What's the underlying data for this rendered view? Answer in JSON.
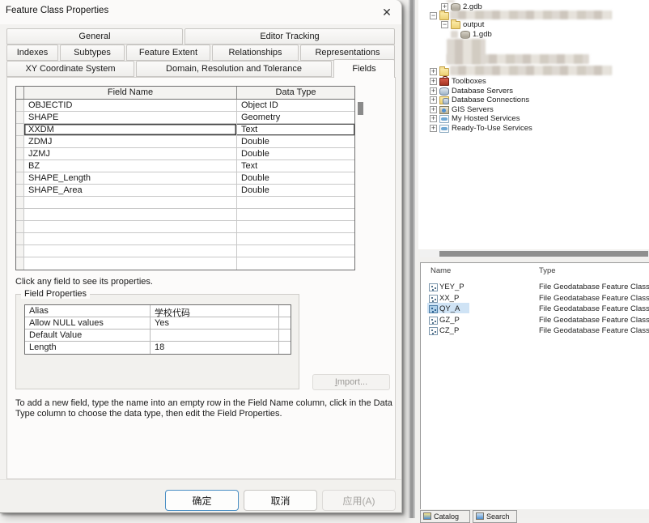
{
  "icons": {
    "close": "✕",
    "plus": "+",
    "minus": "−"
  },
  "dialog": {
    "title": "Feature Class Properties",
    "tabs": {
      "general": "General",
      "editor_tracking": "Editor Tracking",
      "indexes": "Indexes",
      "subtypes": "Subtypes",
      "feature_extent": "Feature Extent",
      "relationships": "Relationships",
      "representations": "Representations",
      "xy_coordinate_system": "XY Coordinate System",
      "domain_resolution_tolerance": "Domain, Resolution and Tolerance",
      "fields": "Fields"
    },
    "fields_table": {
      "header_name": "Field Name",
      "header_type": "Data Type",
      "rows": [
        {
          "name": "OBJECTID",
          "type": "Object ID"
        },
        {
          "name": "SHAPE",
          "type": "Geometry"
        },
        {
          "name": "XXDM",
          "type": "Text"
        },
        {
          "name": "ZDMJ",
          "type": "Double"
        },
        {
          "name": "JZMJ",
          "type": "Double"
        },
        {
          "name": "BZ",
          "type": "Text"
        },
        {
          "name": "SHAPE_Length",
          "type": "Double"
        },
        {
          "name": "SHAPE_Area",
          "type": "Double"
        }
      ]
    },
    "hint": "Click any field to see its properties.",
    "field_properties": {
      "title": "Field Properties",
      "rows": [
        {
          "label": "Alias",
          "value": "学校代码"
        },
        {
          "label": "Allow NULL values",
          "value": "Yes"
        },
        {
          "label": "Default Value",
          "value": ""
        },
        {
          "label": "Length",
          "value": "18"
        }
      ]
    },
    "import_button": "Import...",
    "instruction": "To add a new field, type the name into an empty row in the Field Name column, click in the Data Type column to choose the data type, then edit the Field Properties.",
    "buttons": {
      "ok": "确定",
      "cancel": "取消",
      "apply": "应用(A)"
    }
  },
  "catalog_tree": {
    "items": [
      {
        "label": "2.gdb"
      },
      {
        "label": "output"
      },
      {
        "label": "1.gdb"
      },
      {
        "label": "Toolboxes"
      },
      {
        "label": "Database Servers"
      },
      {
        "label": "Database Connections"
      },
      {
        "label": "GIS Servers"
      },
      {
        "label": "My Hosted Services"
      },
      {
        "label": "Ready-To-Use Services"
      }
    ]
  },
  "contents": {
    "col_name": "Name",
    "col_type": "Type",
    "rows": [
      {
        "name": "YEY_P",
        "type": "File Geodatabase Feature Class"
      },
      {
        "name": "XX_P",
        "type": "File Geodatabase Feature Class"
      },
      {
        "name": "QY_A",
        "type": "File Geodatabase Feature Class"
      },
      {
        "name": "GZ_P",
        "type": "File Geodatabase Feature Class"
      },
      {
        "name": "CZ_P",
        "type": "File Geodatabase Feature Class"
      }
    ]
  },
  "bottom_tabs": {
    "catalog": "Catalog",
    "search": "Search"
  }
}
